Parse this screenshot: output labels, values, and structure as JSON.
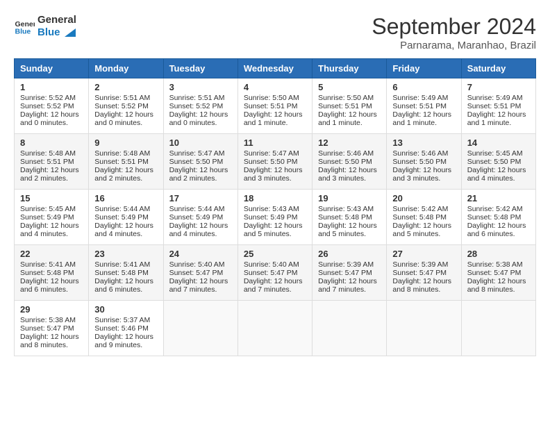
{
  "header": {
    "logo_line1": "General",
    "logo_line2": "Blue",
    "month_title": "September 2024",
    "location": "Parnarama, Maranhao, Brazil"
  },
  "days_of_week": [
    "Sunday",
    "Monday",
    "Tuesday",
    "Wednesday",
    "Thursday",
    "Friday",
    "Saturday"
  ],
  "weeks": [
    [
      {
        "day": "1",
        "sunrise": "5:52 AM",
        "sunset": "5:52 PM",
        "daylight": "12 hours and 0 minutes."
      },
      {
        "day": "2",
        "sunrise": "5:51 AM",
        "sunset": "5:52 PM",
        "daylight": "12 hours and 0 minutes."
      },
      {
        "day": "3",
        "sunrise": "5:51 AM",
        "sunset": "5:52 PM",
        "daylight": "12 hours and 0 minutes."
      },
      {
        "day": "4",
        "sunrise": "5:50 AM",
        "sunset": "5:51 PM",
        "daylight": "12 hours and 1 minute."
      },
      {
        "day": "5",
        "sunrise": "5:50 AM",
        "sunset": "5:51 PM",
        "daylight": "12 hours and 1 minute."
      },
      {
        "day": "6",
        "sunrise": "5:49 AM",
        "sunset": "5:51 PM",
        "daylight": "12 hours and 1 minute."
      },
      {
        "day": "7",
        "sunrise": "5:49 AM",
        "sunset": "5:51 PM",
        "daylight": "12 hours and 1 minute."
      }
    ],
    [
      {
        "day": "8",
        "sunrise": "5:48 AM",
        "sunset": "5:51 PM",
        "daylight": "12 hours and 2 minutes."
      },
      {
        "day": "9",
        "sunrise": "5:48 AM",
        "sunset": "5:51 PM",
        "daylight": "12 hours and 2 minutes."
      },
      {
        "day": "10",
        "sunrise": "5:47 AM",
        "sunset": "5:50 PM",
        "daylight": "12 hours and 2 minutes."
      },
      {
        "day": "11",
        "sunrise": "5:47 AM",
        "sunset": "5:50 PM",
        "daylight": "12 hours and 3 minutes."
      },
      {
        "day": "12",
        "sunrise": "5:46 AM",
        "sunset": "5:50 PM",
        "daylight": "12 hours and 3 minutes."
      },
      {
        "day": "13",
        "sunrise": "5:46 AM",
        "sunset": "5:50 PM",
        "daylight": "12 hours and 3 minutes."
      },
      {
        "day": "14",
        "sunrise": "5:45 AM",
        "sunset": "5:50 PM",
        "daylight": "12 hours and 4 minutes."
      }
    ],
    [
      {
        "day": "15",
        "sunrise": "5:45 AM",
        "sunset": "5:49 PM",
        "daylight": "12 hours and 4 minutes."
      },
      {
        "day": "16",
        "sunrise": "5:44 AM",
        "sunset": "5:49 PM",
        "daylight": "12 hours and 4 minutes."
      },
      {
        "day": "17",
        "sunrise": "5:44 AM",
        "sunset": "5:49 PM",
        "daylight": "12 hours and 4 minutes."
      },
      {
        "day": "18",
        "sunrise": "5:43 AM",
        "sunset": "5:49 PM",
        "daylight": "12 hours and 5 minutes."
      },
      {
        "day": "19",
        "sunrise": "5:43 AM",
        "sunset": "5:48 PM",
        "daylight": "12 hours and 5 minutes."
      },
      {
        "day": "20",
        "sunrise": "5:42 AM",
        "sunset": "5:48 PM",
        "daylight": "12 hours and 5 minutes."
      },
      {
        "day": "21",
        "sunrise": "5:42 AM",
        "sunset": "5:48 PM",
        "daylight": "12 hours and 6 minutes."
      }
    ],
    [
      {
        "day": "22",
        "sunrise": "5:41 AM",
        "sunset": "5:48 PM",
        "daylight": "12 hours and 6 minutes."
      },
      {
        "day": "23",
        "sunrise": "5:41 AM",
        "sunset": "5:48 PM",
        "daylight": "12 hours and 6 minutes."
      },
      {
        "day": "24",
        "sunrise": "5:40 AM",
        "sunset": "5:47 PM",
        "daylight": "12 hours and 7 minutes."
      },
      {
        "day": "25",
        "sunrise": "5:40 AM",
        "sunset": "5:47 PM",
        "daylight": "12 hours and 7 minutes."
      },
      {
        "day": "26",
        "sunrise": "5:39 AM",
        "sunset": "5:47 PM",
        "daylight": "12 hours and 7 minutes."
      },
      {
        "day": "27",
        "sunrise": "5:39 AM",
        "sunset": "5:47 PM",
        "daylight": "12 hours and 8 minutes."
      },
      {
        "day": "28",
        "sunrise": "5:38 AM",
        "sunset": "5:47 PM",
        "daylight": "12 hours and 8 minutes."
      }
    ],
    [
      {
        "day": "29",
        "sunrise": "5:38 AM",
        "sunset": "5:47 PM",
        "daylight": "12 hours and 8 minutes."
      },
      {
        "day": "30",
        "sunrise": "5:37 AM",
        "sunset": "5:46 PM",
        "daylight": "12 hours and 9 minutes."
      },
      null,
      null,
      null,
      null,
      null
    ]
  ],
  "labels": {
    "sunrise_prefix": "Sunrise: ",
    "sunset_prefix": "Sunset: ",
    "daylight_prefix": "Daylight: "
  }
}
